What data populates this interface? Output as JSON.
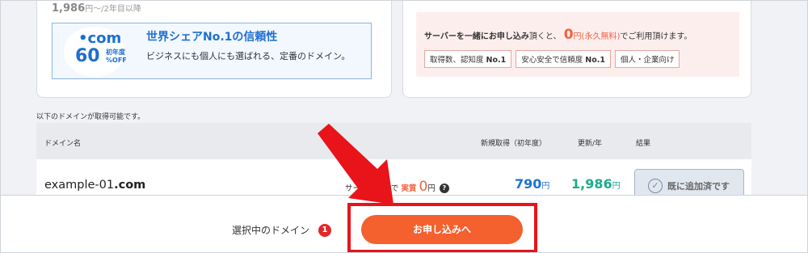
{
  "plan_card": {
    "renew_price": "1,986",
    "renew_suffix": "円〜/2年目以降",
    "promo": {
      "tld": "•com",
      "discount": "60",
      "discount_unit": "%OFF",
      "badge_sub": "初年度",
      "title": "世界シェアNo.1の信頼性",
      "description": "ビジネスにも個人にも選ばれる、定番のドメイン。"
    }
  },
  "server_card": {
    "text_bold": "サーバーを一緒にお申し込み",
    "text_mid": "頂くと、",
    "zero": "0",
    "free_label": "円(永久無料)",
    "text_end": "でご利用頂けます。",
    "tags": [
      {
        "text": "取得数、認知度 ",
        "bold": "No.1"
      },
      {
        "text": "安心安全で信頼度 ",
        "bold": "No.1"
      },
      {
        "text": "個人・企業向け",
        "bold": ""
      }
    ]
  },
  "availability_note": "以下のドメインが取得可能です。",
  "table": {
    "headers": {
      "domain": "ドメイン名",
      "new_price": "新規取得（初年度）",
      "renew_price": "更新/年",
      "result": "結果"
    },
    "rows": [
      {
        "domain_name": "example-01",
        "tld": ".com",
        "server_note_prefix": "サーバー契約で",
        "server_note_jitsu": "実質",
        "server_note_zero": "0",
        "server_note_unit": "円",
        "help_icon": "?",
        "new_price": "790",
        "new_price_unit": "円",
        "renew_price": "1,986",
        "renew_price_unit": "円",
        "result_label": "既に追加済です"
      }
    ]
  },
  "footer": {
    "selected_label": "選択中のドメイン",
    "selected_count": "1",
    "apply_button": "お申し込みへ"
  },
  "colors": {
    "accent_orange": "#f4602e",
    "highlight_red": "#e8141a",
    "price_blue": "#1e73d8",
    "price_green": "#1eaa8c"
  },
  "icons": [
    "check-circle-icon",
    "help-icon",
    "annotation-arrow-icon"
  ]
}
